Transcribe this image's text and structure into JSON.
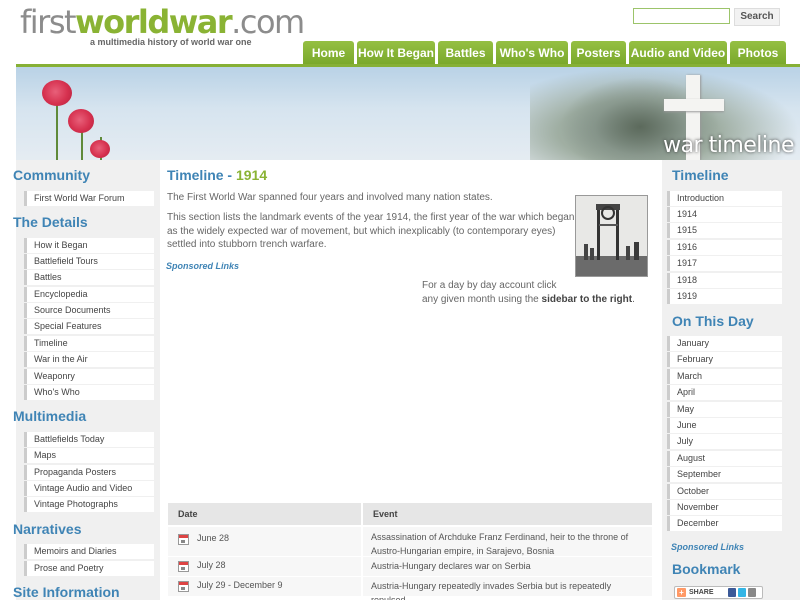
{
  "header": {
    "logo_part1": "first",
    "logo_part2": "worldwar",
    "logo_part3": ".com",
    "tagline": "a multimedia history of world war one",
    "search_placeholder": "",
    "search_button": "Search"
  },
  "nav": [
    "Home",
    "How It Began",
    "Battles",
    "Who's Who",
    "Posters",
    "Audio and Video",
    "Photos"
  ],
  "banner": {
    "label": "war timeline"
  },
  "left_sidebar": {
    "sections": [
      {
        "heading": "Community",
        "items": [
          "First World War Forum"
        ]
      },
      {
        "heading": "The Details",
        "items": [
          "How it Began",
          "Battlefield Tours",
          "Battles",
          "Encyclopedia",
          "Source Documents",
          "Special Features",
          "Timeline",
          "War in the Air",
          "Weaponry",
          "Who's Who"
        ]
      },
      {
        "heading": "Multimedia",
        "items": [
          "Battlefields Today",
          "Maps",
          "Propaganda Posters",
          "Vintage Audio and Video",
          "Vintage Photographs"
        ]
      },
      {
        "heading": "Narratives",
        "items": [
          "Memoirs and Diaries",
          "Prose and Poetry"
        ]
      },
      {
        "heading": "Site Information",
        "items": []
      }
    ]
  },
  "main": {
    "title_prefix": "Timeline - ",
    "title_year": "1914",
    "intro1": "The First World War spanned four years and involved many nation states.",
    "intro2_l1": "This section lists the landmark events of the year 1914, the first year of the war which began",
    "intro2_l2": "as the widely expected war of movement, but which inexplicably (to contemporary eyes)",
    "intro2_l3": "settled into stubborn trench warfare.",
    "sponsored": "Sponsored Links",
    "day_l1": "For a day by day account click",
    "day_l2_pre": "any given month using the ",
    "day_l2_bold": "sidebar to the right",
    "day_l2_post": "."
  },
  "table": {
    "headers": [
      "Date",
      "Event"
    ],
    "rows": [
      {
        "date": "June 28",
        "event_l1": "Assassination of Archduke Franz Ferdinand, heir to the throne of",
        "event_l2": "Austro-Hungarian empire, in Sarajevo, Bosnia"
      },
      {
        "date": "July 28",
        "event_l1": "Austria-Hungary declares war on Serbia",
        "event_l2": ""
      },
      {
        "date": "July 29 - December 9",
        "event_l1": "Austria-Hungary repeatedly invades Serbia but is repeatedly repulsed",
        "event_l2": ""
      }
    ]
  },
  "right_sidebar": {
    "timeline_heading": "Timeline",
    "timeline_items": [
      "Introduction",
      "1914",
      "1915",
      "1916",
      "1917",
      "1918",
      "1919"
    ],
    "onthisday_heading": "On This Day",
    "months": [
      "January",
      "February",
      "March",
      "April",
      "May",
      "June",
      "July",
      "August",
      "September",
      "October",
      "November",
      "December"
    ],
    "sponsored": "Sponsored Links",
    "bookmark_heading": "Bookmark",
    "share_label": "SHARE"
  },
  "colors": {
    "accent_green": "#8ab334",
    "link_blue": "#3f84b5",
    "nav_green": "#86b035"
  }
}
